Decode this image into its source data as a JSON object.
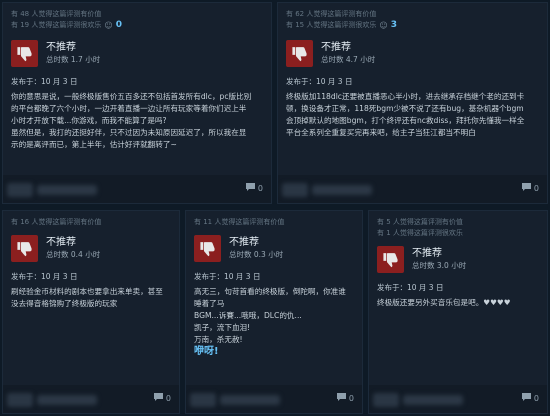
{
  "reviews": [
    {
      "helpful_line": "有 48 人觉得这篇评测有价值",
      "funny_line": "有 19 人觉得这篇评测很欢乐",
      "funny_count": "0",
      "verdict": "不推荐",
      "hours": "总时数 1.7 小时",
      "posted": "发布于：10 月 3 日",
      "body_lines": [
        "你的意思是说，一般终极版售价五百多还不包括首发所有dlc，pc版比别",
        "的平台都晚了六个小时，一边开着直播一边让所有玩家等着你们迟上半",
        "小时才开放下载...你游戏，而我不能算了是吗?",
        "虽然但是，我打的还挺好伴，只不过因为未知原因延迟了，所以我在显",
        "示的是离评而已，第上半年，估计好评就翻转了~"
      ],
      "comments": "0"
    },
    {
      "helpful_line": "有 62 人觉得这篇评测有价值",
      "funny_line": "有 15 人觉得这篇评测很欢乐",
      "funny_count": "3",
      "verdict": "不推荐",
      "hours": "总时数 4.7 小时",
      "posted": "发布于：10 月 3 日",
      "body_lines": [
        "终极版加118dlc还要被直播恶心半小时，进去继承存档继个老的还到卡",
        "顿，换设备才正常，118死bgm少被不说了还有bug，基杂机器个bgm",
        "会顶掉默认的地图bgm，打个终评还有nc救diss，拜托你先懂我一样全",
        "平台全系列全重复买完再来吧，给主子当狂江都当不明白"
      ],
      "comments": "0"
    },
    {
      "helpful_line": "有 16 人觉得这篇评测有价值",
      "funny_line": "",
      "funny_count": "",
      "verdict": "不推荐",
      "hours": "总时数 0.4 小时",
      "posted": "发布于：10 月 3 日",
      "body_lines": [
        "刷经验金币材料的剧本也要拿出来单卖，甚至",
        "没去得音格锦购了终极版的玩家"
      ],
      "comments": "0"
    },
    {
      "helpful_line": "有 11 人觉得这篇评测有价值",
      "funny_line": "",
      "funny_count": "",
      "verdict": "不推荐",
      "hours": "总时数 0.3 小时",
      "posted": "发布于：10 月 3 日",
      "body_lines": [
        "高无三，句苛首看的终极版，倒陀啊，你准谁",
        "睡着了马",
        "BGM...诉賽...哦哦，DLC的仇...",
        "凯子，流下血泪!",
        "万南，杀无赦!"
      ],
      "emph_line": "咿呀!",
      "comments": "0"
    },
    {
      "helpful_line": "有 5 人觉得这篇评测有价值",
      "funny_line": "有 1 人觉得这篇评测很欢乐",
      "funny_count": "",
      "verdict": "不推荐",
      "hours": "总时数 3.0 小时",
      "posted": "发布于：10 月 3 日",
      "body_lines": [
        "终极版还要另外买音乐包是吧。♥♥♥♥"
      ],
      "comments": "0"
    }
  ]
}
